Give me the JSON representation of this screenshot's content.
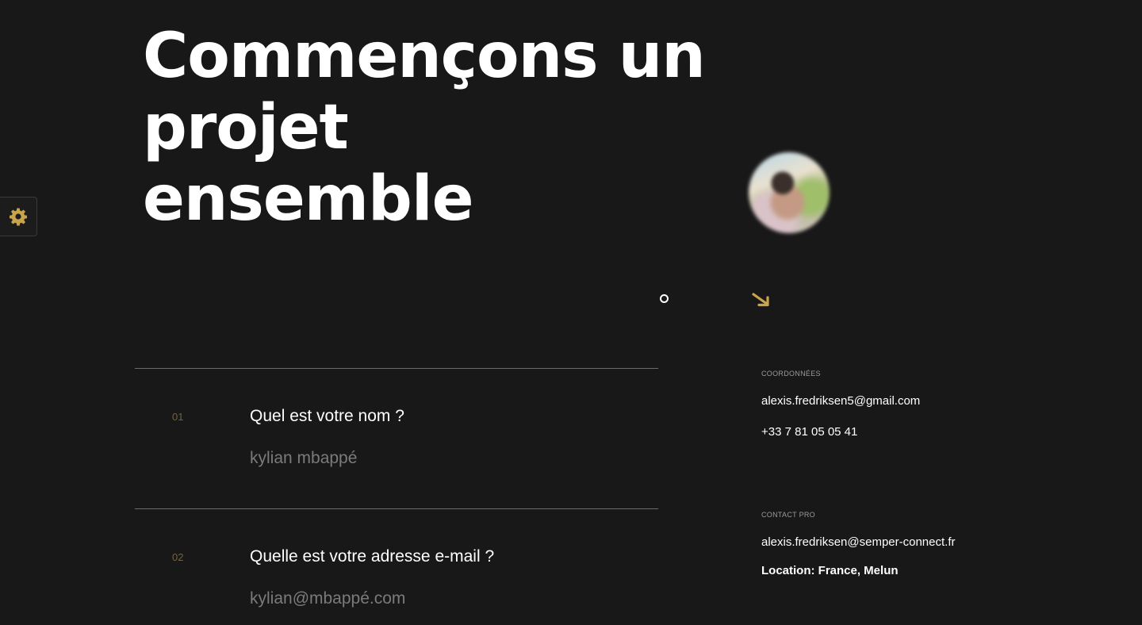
{
  "hero": {
    "title_lines": [
      "Commençons un",
      "projet",
      "ensemble"
    ]
  },
  "settings": {
    "icon": "gear-icon",
    "color": "#c9a44c"
  },
  "accent_color": "#c9a44c",
  "background_color": "#181818",
  "avatar": {
    "icon": "profile-photo"
  },
  "form": {
    "questions": [
      {
        "number": "01",
        "label": "Quel est votre nom ?",
        "value": "kylian mbappé"
      },
      {
        "number": "02",
        "label": "Quelle est votre adresse e-mail ?",
        "value": "kylian@mbappé.com"
      }
    ]
  },
  "contact": {
    "coordinates": {
      "heading": "COORDONNÉES",
      "email": "alexis.fredriksen5@gmail.com",
      "phone": "+33 7 81 05 05 41"
    },
    "pro": {
      "heading": "CONTACT PRO",
      "email": "alexis.fredriksen@semper-connect.fr",
      "location": "Location: France, Melun"
    }
  }
}
